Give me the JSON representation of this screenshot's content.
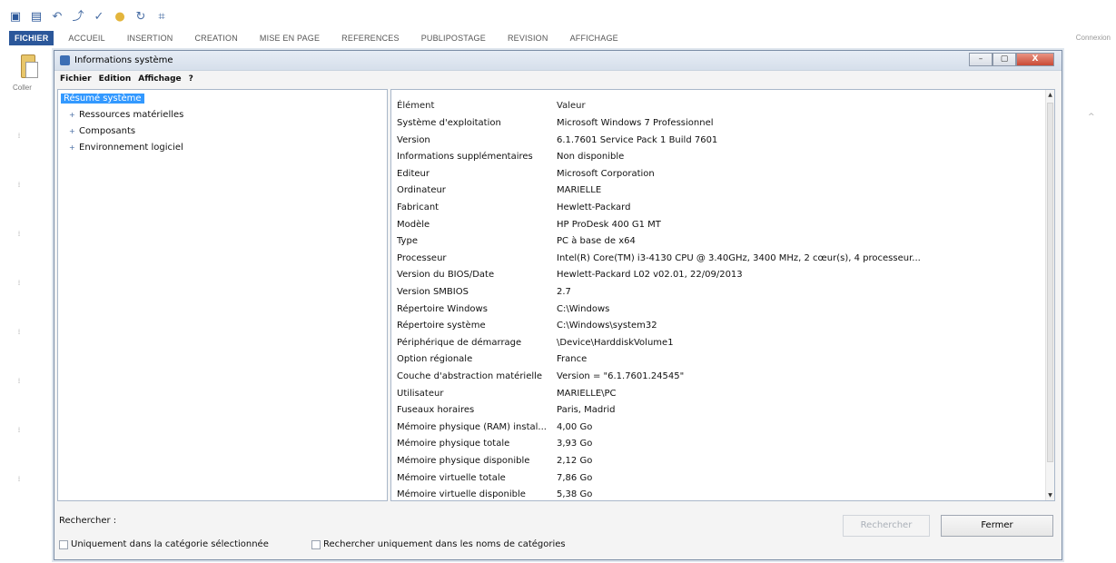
{
  "word": {
    "qat_icons": [
      "word-logo-icon",
      "save-icon",
      "undo-icon",
      "redo-icon",
      "spellcheck-icon",
      "highlight-icon",
      "refresh-icon",
      "format-painter-icon"
    ],
    "tabs": [
      "FICHIER",
      "ACCUEIL",
      "INSERTION",
      "CREATION",
      "MISE EN PAGE",
      "REFERENCES",
      "PUBLIPOSTAGE",
      "REVISION",
      "AFFICHAGE"
    ],
    "connexion": "Connexion",
    "paste_label": "Coller"
  },
  "dialog": {
    "title": "Informations système",
    "controls": {
      "minimize": "–",
      "maximize": "▢",
      "close": "X"
    },
    "menu": [
      "Fichier",
      "Edition",
      "Affichage",
      "?"
    ],
    "tree": {
      "selected": "Résumé système",
      "items": [
        "Ressources matérielles",
        "Composants",
        "Environnement logiciel"
      ]
    },
    "list": {
      "header_key": "Élément",
      "header_value": "Valeur",
      "rows": [
        {
          "k": "Système d'exploitation",
          "v": "Microsoft Windows 7 Professionnel"
        },
        {
          "k": "Version",
          "v": "6.1.7601 Service Pack 1 Build 7601"
        },
        {
          "k": "Informations supplémentaires",
          "v": "Non disponible"
        },
        {
          "k": "Editeur",
          "v": "Microsoft Corporation"
        },
        {
          "k": "Ordinateur",
          "v": "MARIELLE"
        },
        {
          "k": "Fabricant",
          "v": "Hewlett-Packard"
        },
        {
          "k": "Modèle",
          "v": "HP ProDesk 400 G1 MT"
        },
        {
          "k": "Type",
          "v": "PC à base de x64"
        },
        {
          "k": "Processeur",
          "v": "Intel(R) Core(TM) i3-4130 CPU @ 3.40GHz, 3400 MHz, 2 cœur(s), 4 processeur..."
        },
        {
          "k": "Version du BIOS/Date",
          "v": "Hewlett-Packard L02 v02.01, 22/09/2013"
        },
        {
          "k": "Version SMBIOS",
          "v": "2.7"
        },
        {
          "k": "Répertoire Windows",
          "v": "C:\\Windows"
        },
        {
          "k": "Répertoire système",
          "v": "C:\\Windows\\system32"
        },
        {
          "k": "Périphérique de démarrage",
          "v": "\\Device\\HarddiskVolume1"
        },
        {
          "k": "Option régionale",
          "v": "France"
        },
        {
          "k": "Couche d'abstraction matérielle",
          "v": "Version = \"6.1.7601.24545\""
        },
        {
          "k": "Utilisateur",
          "v": "MARIELLE\\PC"
        },
        {
          "k": "Fuseaux horaires",
          "v": "Paris, Madrid"
        },
        {
          "k": "Mémoire physique (RAM) instal...",
          "v": "4,00 Go"
        },
        {
          "k": "Mémoire physique totale",
          "v": "3,93 Go"
        },
        {
          "k": "Mémoire physique disponible",
          "v": "2,12 Go"
        },
        {
          "k": "Mémoire virtuelle totale",
          "v": "7,86 Go"
        },
        {
          "k": "Mémoire virtuelle disponible",
          "v": "5,38 Go"
        }
      ]
    },
    "search": {
      "label": "Rechercher :",
      "search_button": "Rechercher",
      "close_button": "Fermer",
      "only_selected_category": "Uniquement dans la catégorie sélectionnée",
      "only_category_names": "Rechercher uniquement dans les noms de catégories"
    }
  }
}
